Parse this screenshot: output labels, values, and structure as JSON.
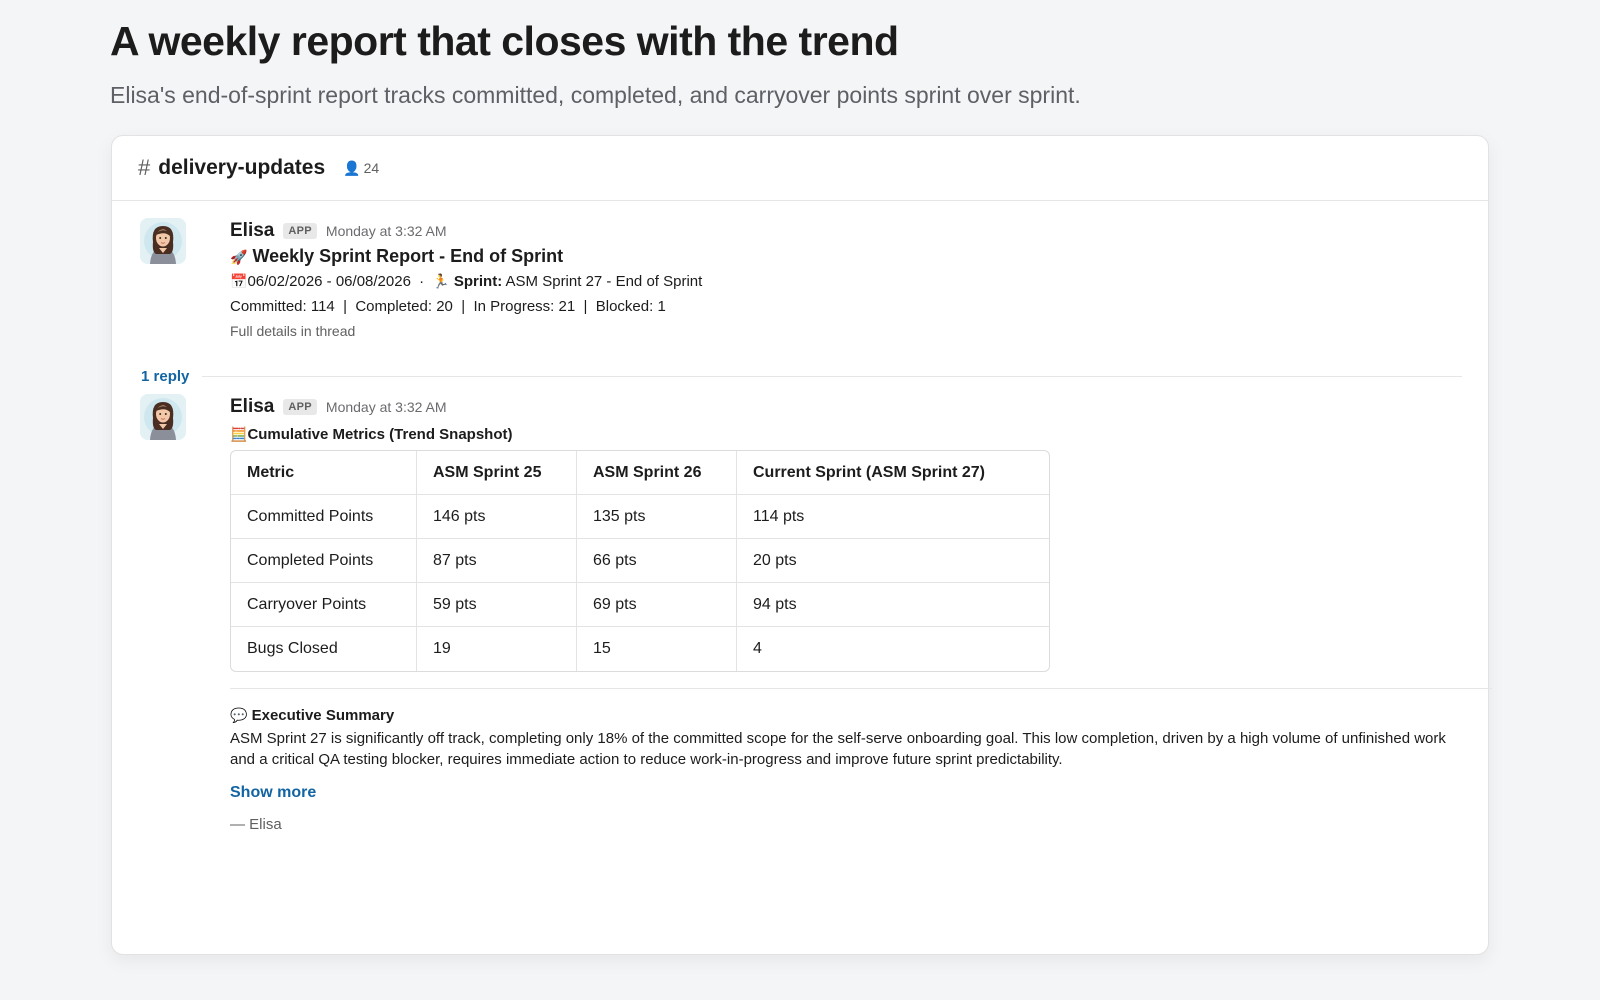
{
  "page": {
    "title": "A weekly report that closes with the trend",
    "subtitle": "Elisa's end-of-sprint report tracks committed, completed, and carryover points sprint over sprint."
  },
  "channel": {
    "hash": "#",
    "name": "delivery-updates",
    "member_count": "24"
  },
  "message1": {
    "author": "Elisa",
    "badge": "APP",
    "timestamp": "Monday at 3:32 AM",
    "title_emoji": "🚀",
    "title": "Weekly Sprint Report - End of Sprint",
    "date_emoji": "📅",
    "date_range": "06/02/2026 - 06/08/2026",
    "separator": "·",
    "sprint_emoji": "🏃",
    "sprint_label": "Sprint:",
    "sprint_value": "ASM Sprint 27 - End of Sprint",
    "stats": "Committed: 114  |  Completed: 20  |  In Progress: 21  |  Blocked: 1",
    "details_note": "Full details in thread"
  },
  "thread": {
    "reply_count": "1 reply"
  },
  "message2": {
    "author": "Elisa",
    "badge": "APP",
    "timestamp": "Monday at 3:32 AM",
    "metrics_emoji": "🧮",
    "metrics_title": "Cumulative Metrics (Trend Snapshot)",
    "table": {
      "headers": [
        "Metric",
        "ASM Sprint 25",
        "ASM Sprint 26",
        "Current Sprint (ASM Sprint 27)"
      ],
      "rows": [
        [
          "Committed Points",
          "146 pts",
          "135 pts",
          "114 pts"
        ],
        [
          "Completed Points",
          "87 pts",
          "66 pts",
          "20 pts"
        ],
        [
          "Carryover Points",
          "59 pts",
          "69 pts",
          "94 pts"
        ],
        [
          "Bugs Closed",
          "19",
          "15",
          "4"
        ]
      ]
    },
    "summary_emoji": "💬",
    "summary_title": "Executive Summary",
    "summary_text": "ASM Sprint 27 is significantly off track, completing only 18% of the committed scope for the self-serve onboarding goal. This low completion, driven by a high volume of unfinished work and a critical QA testing blocker, requires immediate action to reduce work-in-progress and improve future sprint predictability.",
    "show_more": "Show more",
    "signoff": "— Elisa"
  },
  "colors": {
    "link": "#1264a3",
    "background": "#f4f5f7"
  }
}
